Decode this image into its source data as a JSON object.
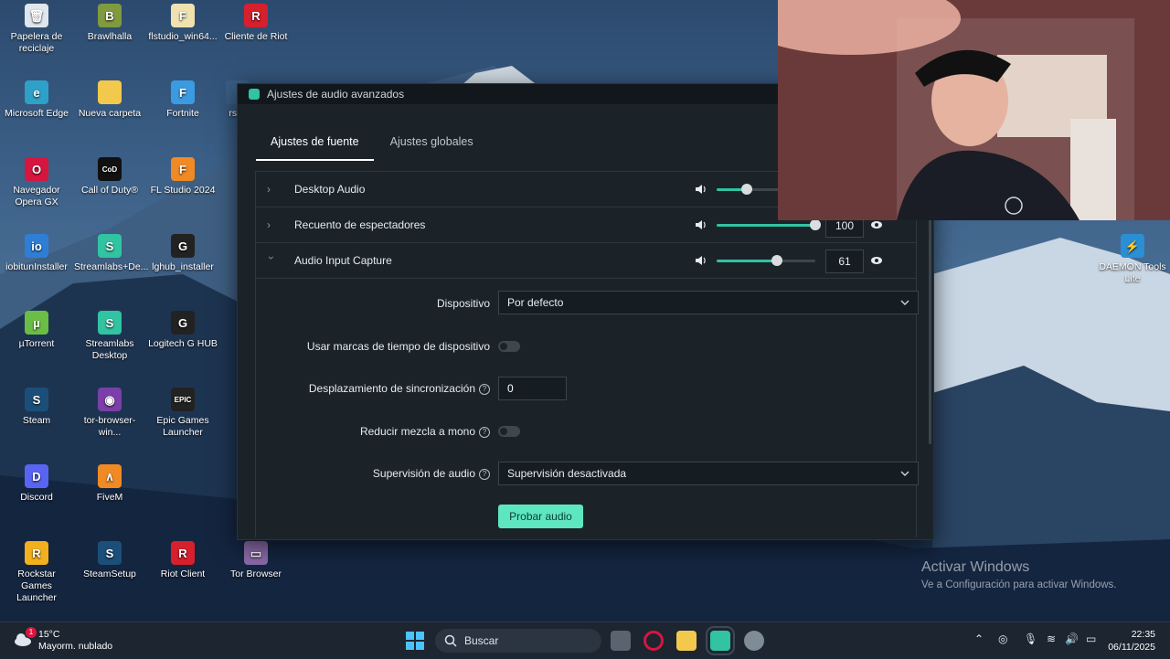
{
  "desktop": {
    "icons": [
      {
        "label": "Papelera de reciclaje",
        "color": "#dfe6ee",
        "glyph": "🗑"
      },
      {
        "label": "Brawlhalla",
        "color": "#7f9a3f",
        "glyph": "B"
      },
      {
        "label": "flstudio_win64...",
        "color": "#efe2b0",
        "glyph": "F"
      },
      {
        "label": "Cliente de Riot",
        "color": "#d6202e",
        "glyph": "R"
      },
      {
        "label": "Microsoft Edge",
        "color": "#2fa0c8",
        "glyph": "e"
      },
      {
        "label": "Nueva carpeta",
        "color": "#f2c94c",
        "glyph": ""
      },
      {
        "label": "Fortnite",
        "color": "#3b9be0",
        "glyph": "F"
      },
      {
        "label": "rsEr",
        "color": "#3b5f87",
        "glyph": ""
      },
      {
        "label": "Navegador Opera GX",
        "color": "#d6163f",
        "glyph": "O"
      },
      {
        "label": "Call of Duty®",
        "color": "#111111",
        "glyph": "CoD"
      },
      {
        "label": "FL Studio 2024",
        "color": "#f08a24",
        "glyph": "F"
      },
      {
        "label": "iobitunInstaller",
        "color": "#2e7ed6",
        "glyph": "io"
      },
      {
        "label": "Streamlabs+De...",
        "color": "#31c3a2",
        "glyph": "S"
      },
      {
        "label": "lghub_installer",
        "color": "#222222",
        "glyph": "G"
      },
      {
        "label": "µTorrent",
        "color": "#6bbe45",
        "glyph": "µ"
      },
      {
        "label": "Streamlabs Desktop",
        "color": "#31c3a2",
        "glyph": "S"
      },
      {
        "label": "Logitech G HUB",
        "color": "#222222",
        "glyph": "G"
      },
      {
        "label": "Steam",
        "color": "#1b4f7a",
        "glyph": "S"
      },
      {
        "label": "tor-browser-win...",
        "color": "#7a3fa8",
        "glyph": "◉"
      },
      {
        "label": "Epic Games Launcher",
        "color": "#222222",
        "glyph": "EPIC"
      },
      {
        "label": "Discord",
        "color": "#5865f2",
        "glyph": "D"
      },
      {
        "label": "FiveM",
        "color": "#f08a24",
        "glyph": "∧"
      },
      {
        "label": "Rockstar Games Launcher",
        "color": "#f2b01e",
        "glyph": "R"
      },
      {
        "label": "SteamSetup",
        "color": "#1b4f7a",
        "glyph": "S"
      },
      {
        "label": "Riot Client",
        "color": "#d6202e",
        "glyph": "R"
      },
      {
        "label": "Tor Browser",
        "color": "#8a6aa8",
        "glyph": "▭"
      },
      {
        "label": "DAEMON Tools Lite",
        "color": "#2b8fd6",
        "glyph": "⚡"
      }
    ]
  },
  "dialog": {
    "title": "Ajustes de audio avanzados",
    "tabs": [
      "Ajustes de fuente",
      "Ajustes globales"
    ],
    "sources": [
      {
        "name": "Desktop Audio",
        "volume": "",
        "level": 0.3,
        "expanded": false
      },
      {
        "name": "Recuento de espectadores",
        "volume": "100",
        "level": 1.0,
        "expanded": false
      },
      {
        "name": "Audio Input Capture",
        "volume": "61",
        "level": 0.61,
        "expanded": true
      }
    ],
    "settings": {
      "device_label": "Dispositivo",
      "device_value": "Por defecto",
      "timestamps_label": "Usar marcas de tiempo de dispositivo",
      "sync_label": "Desplazamiento de sincronización",
      "sync_value": "0",
      "mono_label": "Reducir mezcla a mono",
      "monitor_label": "Supervisión de audio",
      "monitor_value": "Supervisión desactivada",
      "test_button": "Probar audio"
    }
  },
  "watermark": {
    "title": "Activar Windows",
    "subtitle": "Ve a Configuración para activar Windows."
  },
  "taskbar": {
    "weather_temp": "15°C",
    "weather_desc": "Mayorm. nublado",
    "weather_badge": "1",
    "search_placeholder": "Buscar",
    "time": "22:35",
    "date": "06/11/2025"
  },
  "colors": {
    "accent": "#31c3a2",
    "button": "#5ee6c0"
  }
}
